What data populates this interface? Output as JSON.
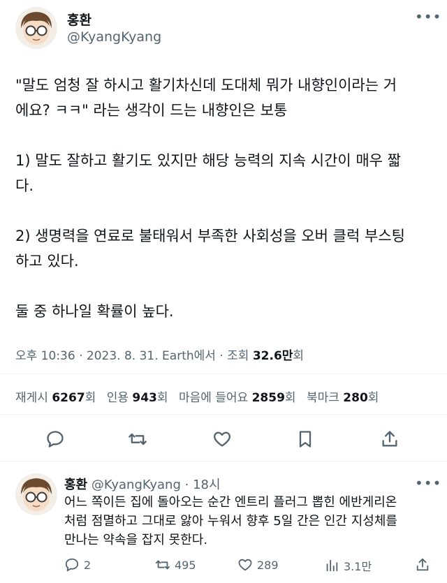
{
  "tweet": {
    "author_name": "홍환",
    "author_handle": "@KyangKyang",
    "more_icon": "more-dots-icon",
    "paragraphs": [
      "\"말도 엄청 잘 하시고 활기차신데 도대체 뭐가 내향인이라는 거\n에요? ㅋㅋ\" 라는 생각이 드는 내향인은 보통",
      "1) 말도 잘하고 활기도 있지만 해당 능력의 지속 시간이 매우 짧\n다.",
      "2) 생명력을 연료로 불태워서 부족한 사회성을 오버 클럭 부스팅\n하고 있다.",
      "둘 중 하나일 확률이 높다."
    ],
    "meta": {
      "time": "오후 10:36",
      "date": "2023. 8. 31.",
      "source": "Earth에서",
      "views_label": "조회",
      "views_value": "32.6만",
      "views_unit": "회",
      "sep": "·"
    },
    "stats": [
      {
        "label": "재게시",
        "value": "6267",
        "unit": "회"
      },
      {
        "label": "인용",
        "value": "943",
        "unit": "회"
      },
      {
        "label": "마음에 들어요",
        "value": "2859",
        "unit": "회"
      },
      {
        "label": "북마크",
        "value": "280",
        "unit": "회"
      }
    ],
    "actions": [
      "reply-icon",
      "retweet-icon",
      "like-icon",
      "bookmark-icon",
      "share-icon"
    ]
  },
  "reply": {
    "author_name": "홍환",
    "author_handle": "@KyangKyang",
    "time": "· 18시",
    "text": "어느 쪽이든 집에 돌아오는 순간 엔트리 플러그 뽑힌 에반게리온\n처럼 점멸하고 그대로 앓아 누워서 향후 5일 간은 인간 지성체를\n만나는 약속을 잡지 못한다.",
    "counts": {
      "replies": "2",
      "retweets": "495",
      "likes": "289",
      "views": "3.1만"
    }
  }
}
